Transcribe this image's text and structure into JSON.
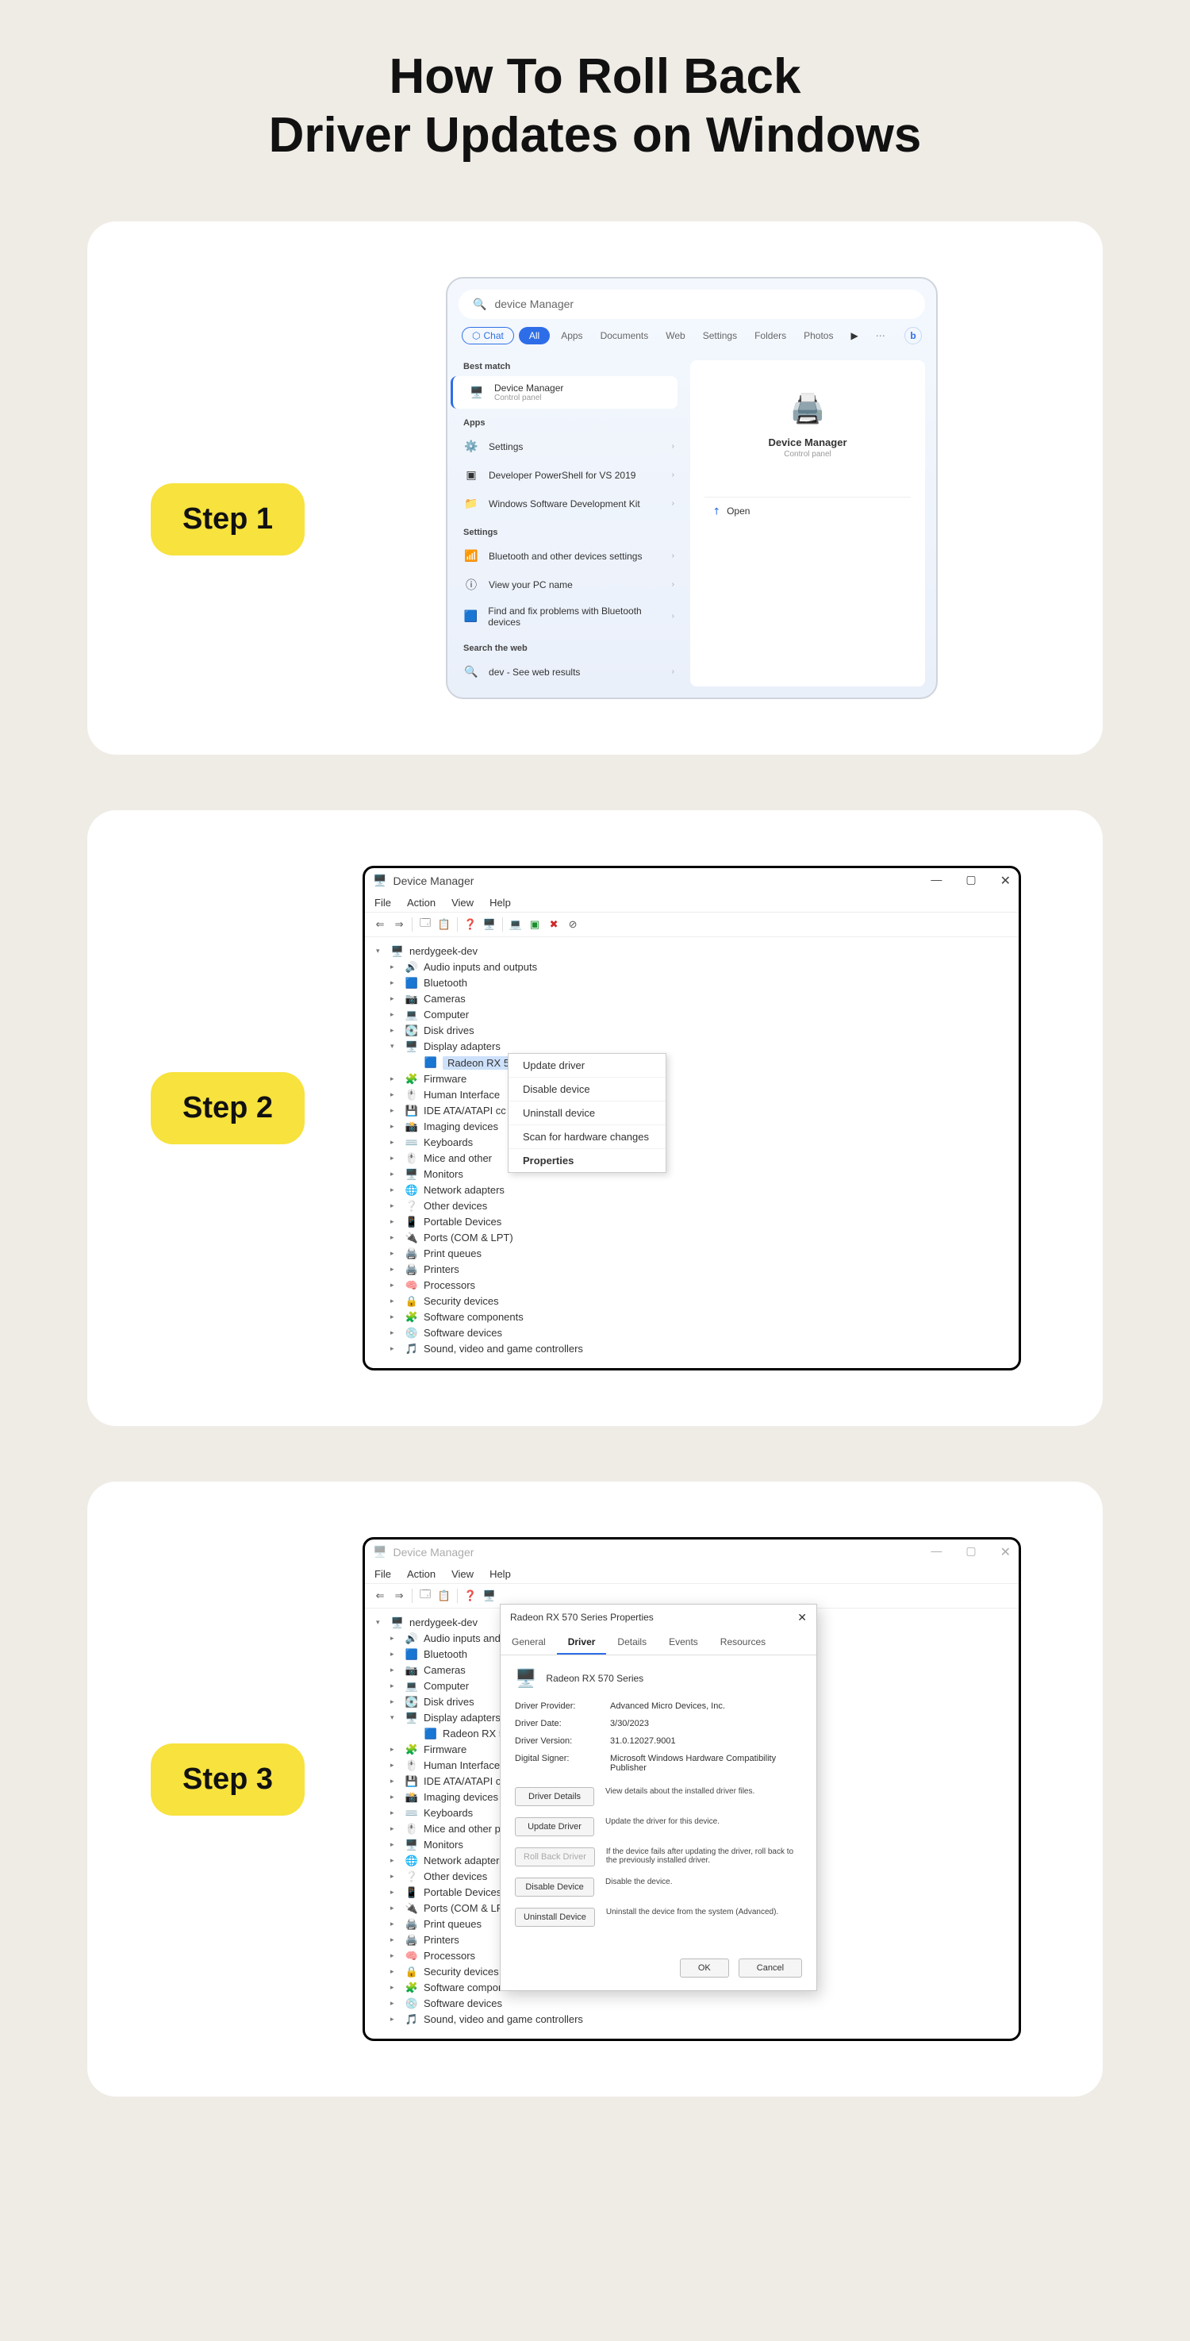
{
  "title_line1": "How To Roll Back",
  "title_line2": "Driver Updates on Windows",
  "steps": {
    "s1": "Step 1",
    "s2": "Step 2",
    "s3": "Step 3"
  },
  "search": {
    "query": "device Manager",
    "tabs": {
      "chat": "Chat",
      "all": "All",
      "apps": "Apps",
      "docs": "Documents",
      "web": "Web",
      "settings": "Settings",
      "folders": "Folders",
      "photos": "Photos"
    },
    "best_match": "Best match",
    "result_title": "Device Manager",
    "result_sub": "Control panel",
    "apps_label": "Apps",
    "apps": {
      "a1": "Settings",
      "a2": "Developer PowerShell for VS 2019",
      "a3": "Windows Software Development Kit"
    },
    "settings_label": "Settings",
    "settings": {
      "s1": "Bluetooth and other devices settings",
      "s2": "View your PC name",
      "s3": "Find and fix problems with Bluetooth devices"
    },
    "search_web": "Search the web",
    "web_item": "dev - See web results",
    "right": {
      "title": "Device Manager",
      "sub": "Control panel",
      "open": "Open"
    }
  },
  "dm": {
    "title": "Device Manager",
    "menu": {
      "file": "File",
      "action": "Action",
      "view": "View",
      "help": "Help"
    },
    "root": "nerdygeek-dev",
    "nodes": {
      "audio": "Audio inputs and outputs",
      "bt": "Bluetooth",
      "cam": "Cameras",
      "comp": "Computer",
      "disk": "Disk drives",
      "disp": "Display adapters",
      "radeon": "Radeon RX 570 Series",
      "fw": "Firmware",
      "hid": "Human Interface Devices",
      "ide": "IDE ATA/ATAPI controllers",
      "img": "Imaging devices",
      "kb": "Keyboards",
      "mouse": "Mice and other pointing devices",
      "mon": "Monitors",
      "net": "Network adapters",
      "other": "Other devices",
      "port": "Portable Devices",
      "ports": "Ports (COM & LPT)",
      "pq": "Print queues",
      "prn": "Printers",
      "proc": "Processors",
      "sec": "Security devices",
      "swc": "Software components",
      "swd": "Software devices",
      "svg": "Sound, video and game controllers"
    },
    "hid_short": "Human Interface",
    "ide_short": "IDE ATA/ATAPI cc",
    "mouse_short": "Mice and other",
    "ctx": {
      "upd": "Update driver",
      "dis": "Disable device",
      "uni": "Uninstall device",
      "scan": "Scan for hardware changes",
      "prop": "Properties"
    }
  },
  "prop": {
    "title": "Radeon RX 570 Series Properties",
    "tabs": {
      "general": "General",
      "driver": "Driver",
      "details": "Details",
      "events": "Events",
      "resources": "Resources"
    },
    "device": "Radeon RX 570 Series",
    "labels": {
      "provider": "Driver Provider:",
      "date": "Driver Date:",
      "version": "Driver Version:",
      "signer": "Digital Signer:"
    },
    "values": {
      "provider": "Advanced Micro Devices, Inc.",
      "date": "3/30/2023",
      "version": "31.0.12027.9001",
      "signer": "Microsoft Windows Hardware Compatibility Publisher"
    },
    "buttons": {
      "details": "Driver Details",
      "update": "Update Driver",
      "rollback": "Roll Back Driver",
      "disable": "Disable Device",
      "uninstall": "Uninstall Device",
      "ok": "OK",
      "cancel": "Cancel"
    },
    "desc": {
      "details": "View details about the installed driver files.",
      "update": "Update the driver for this device.",
      "rollback": "If the device fails after updating the driver, roll back to the previously installed driver.",
      "disable": "Disable the device.",
      "uninstall": "Uninstall the device from the system (Advanced)."
    }
  }
}
